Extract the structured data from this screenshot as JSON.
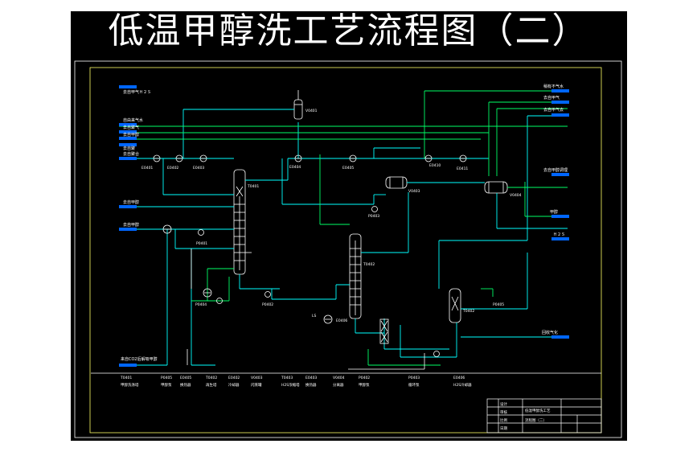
{
  "title": "低温甲醇洗工艺流程图（二）",
  "colors": {
    "background": "#000000",
    "page": "#ffffff",
    "frame": "#ffffff",
    "inner_border": "#ffff66",
    "cyan_line": "#00ffff",
    "green_line": "#00ff66",
    "white_line": "#ffffff",
    "connector": "#0066ff"
  },
  "left_inputs": [
    {
      "id": "in1",
      "label": "去自甲气Ｈ２Ｓ"
    },
    {
      "id": "in2",
      "label": "自由来气水"
    },
    {
      "id": "in3",
      "label": "去自聚气"
    },
    {
      "id": "in4",
      "label": "去自甲醇"
    },
    {
      "id": "in5",
      "label": "去自聚"
    },
    {
      "id": "in6",
      "label": "去自聚合"
    },
    {
      "id": "in7",
      "label": "去自甲醇"
    },
    {
      "id": "in8",
      "label": "去自甲醇"
    },
    {
      "id": "in9",
      "label": "来自CO2后解吸甲醇"
    }
  ],
  "right_outputs": [
    {
      "id": "out1",
      "label": "稍有不气水"
    },
    {
      "id": "out2",
      "label": "去自甲气"
    },
    {
      "id": "out3",
      "label": "去自甲气去"
    },
    {
      "id": "out4",
      "label": "去自甲醇调理"
    },
    {
      "id": "out5",
      "label": "甲醇"
    },
    {
      "id": "out6",
      "label": "Ｈ２Ｓ"
    },
    {
      "id": "out7",
      "label": "回收气化"
    }
  ],
  "equipment_tags": {
    "tower_main": "T0401",
    "tower_second": "T0402",
    "tower_third": "T0402",
    "vessel_top": "V0401",
    "vessel_mid": "V0403",
    "vessel_right": "V0404",
    "pumps": [
      "P0401",
      "P0402",
      "P0403",
      "P0404",
      "P0405"
    ],
    "exchangers": [
      "E0401",
      "E0402",
      "E0403",
      "E0404",
      "E0405",
      "E0406",
      "E0410",
      "E0411"
    ],
    "steam": "LS"
  },
  "legend": [
    {
      "tag": "T0401",
      "desc": "甲醇洗涤塔"
    },
    {
      "tag": "P0405",
      "desc": "甲醇泵"
    },
    {
      "tag": "E0405",
      "desc": "换热器"
    },
    {
      "tag": "T0402",
      "desc": "再生塔"
    },
    {
      "tag": "E0402",
      "desc": "冷却器"
    },
    {
      "tag": "V0403",
      "desc": "闪蒸罐"
    },
    {
      "tag": "T0403",
      "desc": "H2S浓缩塔"
    },
    {
      "tag": "E0403",
      "desc": "换热器"
    },
    {
      "tag": "V0404",
      "desc": "分离器"
    },
    {
      "tag": "P0402",
      "desc": "甲醇泵"
    },
    {
      "tag": "P0403",
      "desc": "循环泵"
    },
    {
      "tag": "E0406",
      "desc": "H2S冷却器"
    }
  ],
  "title_block": {
    "project": "低温甲醇洗工艺",
    "drawing": "流程图（二）",
    "r1": "设计",
    "r2": "审核",
    "r3": "比例",
    "r4": "日期"
  }
}
